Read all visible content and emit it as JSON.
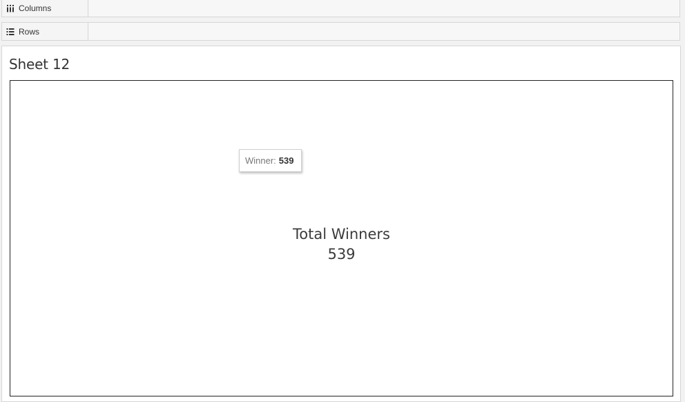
{
  "shelves": {
    "columns": {
      "label": "Columns",
      "icon": "columns-shelf-icon"
    },
    "rows": {
      "label": "Rows",
      "icon": "rows-shelf-icon"
    }
  },
  "sheet": {
    "title": "Sheet 12"
  },
  "kpi": {
    "title": "Total Winners",
    "value": "539"
  },
  "tooltip": {
    "label": "Winner:",
    "value": "539"
  }
}
